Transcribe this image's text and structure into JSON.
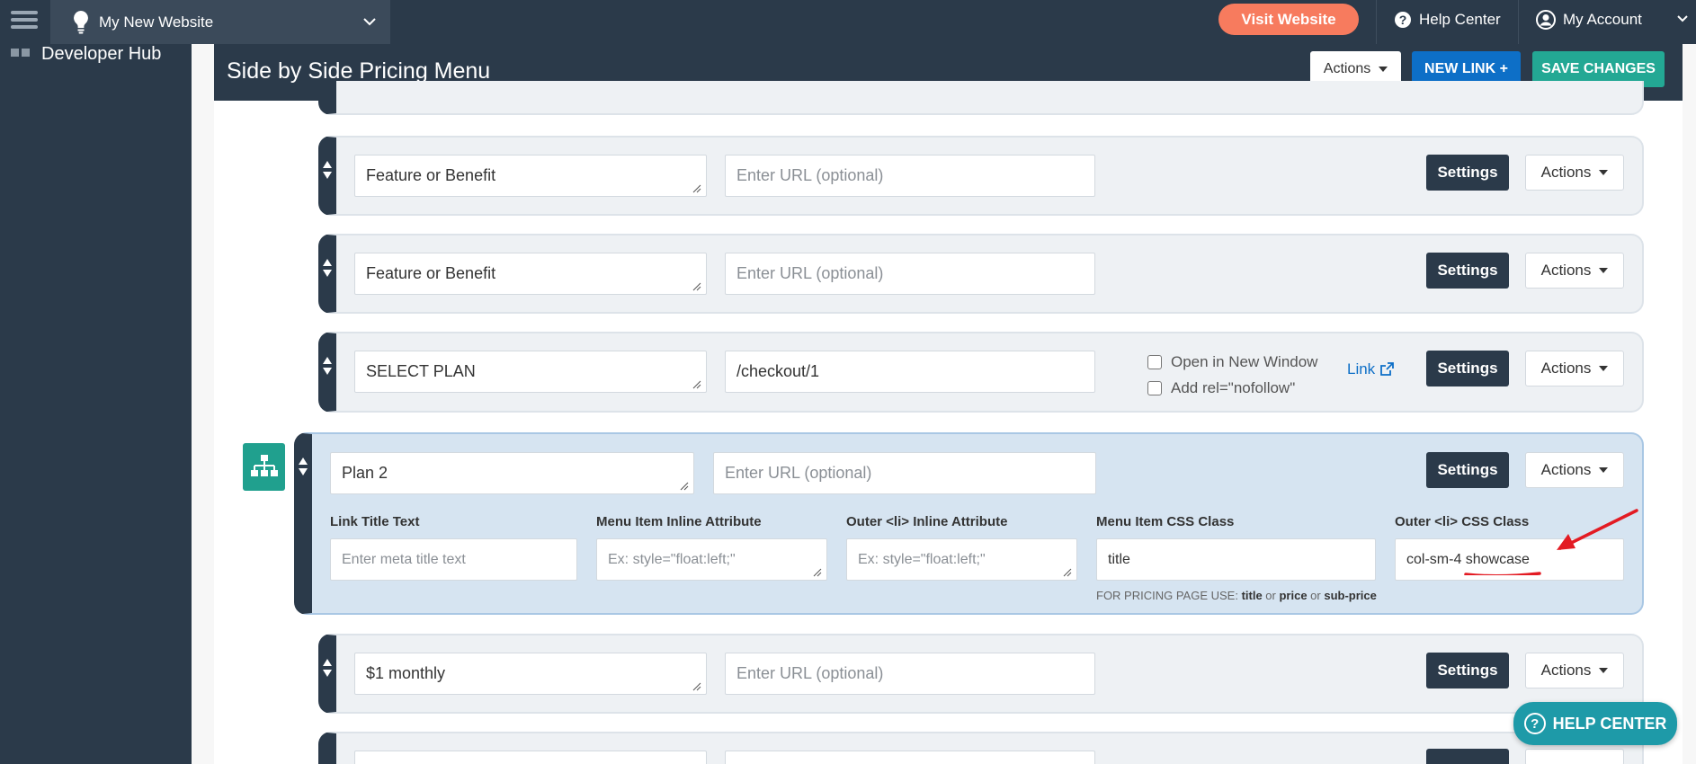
{
  "topbar": {
    "site_name": "My New Website",
    "visit_label": "Visit Website",
    "help_label": "Help Center",
    "account_label": "My Account"
  },
  "sidebar": {
    "items": [
      {
        "label": "Developer Hub"
      }
    ]
  },
  "page": {
    "title": "Side by Side Pricing Menu",
    "actions_label": "Actions",
    "new_link_label": "NEW LINK +",
    "save_label": "SAVE CHANGES"
  },
  "common": {
    "settings_label": "Settings",
    "actions_label": "Actions",
    "url_placeholder": "Enter URL (optional)"
  },
  "rows": [
    {
      "title": "Feature or Benefit",
      "url": ""
    },
    {
      "title": "Feature or Benefit",
      "url": ""
    },
    {
      "title": "SELECT PLAN",
      "url": "/checkout/1",
      "open_new_window_label": "Open in New Window",
      "nofollow_label": "Add rel=\"nofollow\"",
      "link_label": "Link"
    },
    {
      "title": "Plan 2",
      "url": "",
      "fields": {
        "link_title_label": "Link Title Text",
        "link_title_placeholder": "Enter meta title text",
        "inline_attr_label": "Menu Item Inline Attribute",
        "inline_attr_placeholder": "Ex: style=\"float:left;\"",
        "outer_inline_label": "Outer <li> Inline Attribute",
        "outer_inline_placeholder": "Ex: style=\"float:left;\"",
        "css_class_label": "Menu Item CSS Class",
        "css_class_value": "title",
        "outer_css_label": "Outer <li> CSS Class",
        "outer_css_value_prefix": "col-sm-4 ",
        "outer_css_value_highlight": "showcase",
        "hint_prefix": "FOR PRICING PAGE USE: ",
        "hint_title": "title",
        "hint_or1": " or ",
        "hint_price": "price",
        "hint_or2": " or ",
        "hint_subprice": "sub-price"
      }
    },
    {
      "title": "$1 monthly",
      "url": ""
    }
  ],
  "help_center_label": "HELP CENTER",
  "colors": {
    "navy": "#2b3a4a",
    "teal": "#23a894",
    "blue": "#0d6fc7",
    "coral": "#f77b5e",
    "annotation": "#e31b23"
  }
}
